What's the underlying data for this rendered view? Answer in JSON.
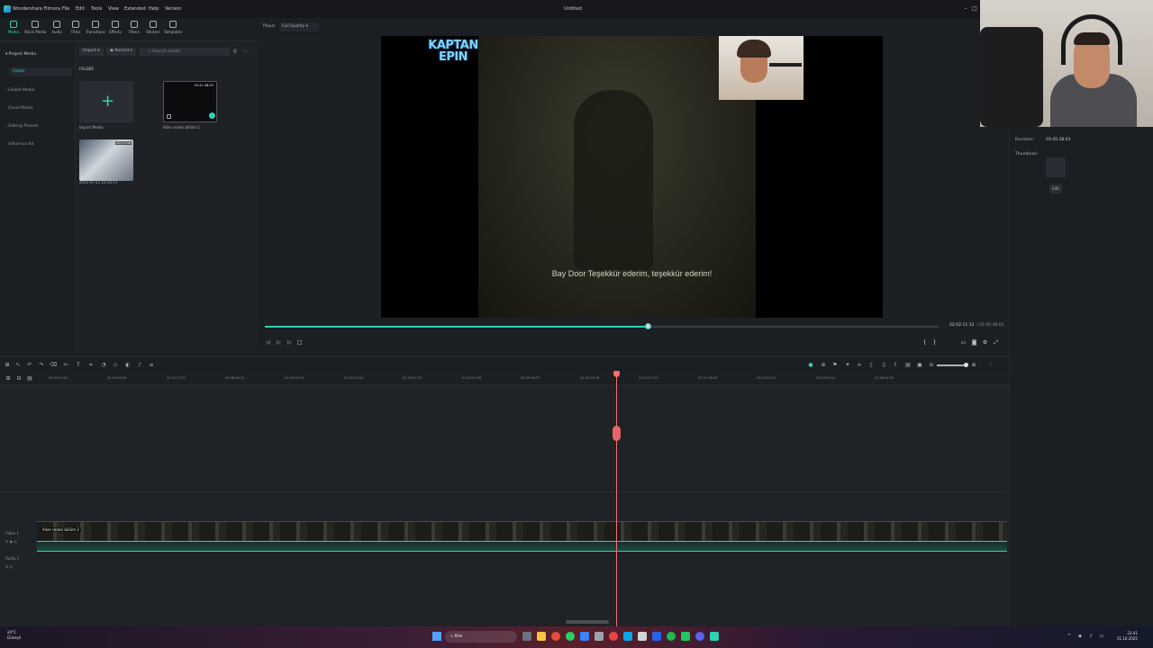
{
  "menubar": {
    "app_name": "Wondershare Filmora",
    "items": [
      "File",
      "Edit",
      "Tools",
      "View",
      "Extended",
      "Help",
      "Version"
    ],
    "document_title": "Untitled"
  },
  "toolbar": {
    "tools": [
      "Media",
      "Stock Media",
      "Audio",
      "Titles",
      "Transitions",
      "Effects",
      "Filters",
      "Stickers",
      "Templates"
    ]
  },
  "sidebar": {
    "project_media": "Project Media",
    "folder": "Folder",
    "items": [
      "Global Media",
      "Cloud Media",
      "Editing Presets",
      "Influence Kit"
    ]
  },
  "media_panel": {
    "import_label": "Import",
    "record_label": "Record",
    "search_placeholder": "Search media",
    "folder_label": "FOLDER",
    "import_media_caption": "Import Media",
    "clip1_caption": "Alien reaksi bölüm 2",
    "clip1_duration": "03:41:38:03",
    "clip2_caption": "2025-07-21 22-35-17",
    "clip2_duration": "00:17:06"
  },
  "player": {
    "label": "Player",
    "quality": "Full Quality",
    "subtitle": "Bay Door Teşekkür ederim, teşekkür ederim!",
    "brand_text": "KAPTAN EPIN",
    "current_time": "02:02:11:12",
    "total_time": "/ 03:45:38:03",
    "progress": 0.57
  },
  "properties": {
    "duration_label": "Duration:",
    "duration_value": "03:45:38:03",
    "thumbnail_label": "Thumbnail:",
    "edit_label": "Edit"
  },
  "timeline": {
    "ruler_ticks": [
      "00:00:00:00",
      "00:16:08:30",
      "00:32:17:21",
      "00:48:26:12",
      "01:04:35:03",
      "01:20:43:24",
      "01:36:52:15",
      "01:53:01:06",
      "02:09:09:27",
      "02:25:18:18",
      "02:41:27:09",
      "02:57:36:00",
      "03:13:44:21",
      "03:29:53:12",
      "03:46:02:03"
    ],
    "video_track_label": "Video 1",
    "audio_track_label": "Audio 1",
    "clip_name": "Alien reaksi bölüm 2"
  },
  "taskbar": {
    "weather_temp": "24°C",
    "weather_desc": "Güneşli",
    "search_placeholder": "Ara",
    "time": "23:41",
    "date": "21.10.2025"
  },
  "colors": {
    "accent": "#2fd1b3",
    "playhead": "#ff6b6b",
    "background": "#1c1f24"
  }
}
